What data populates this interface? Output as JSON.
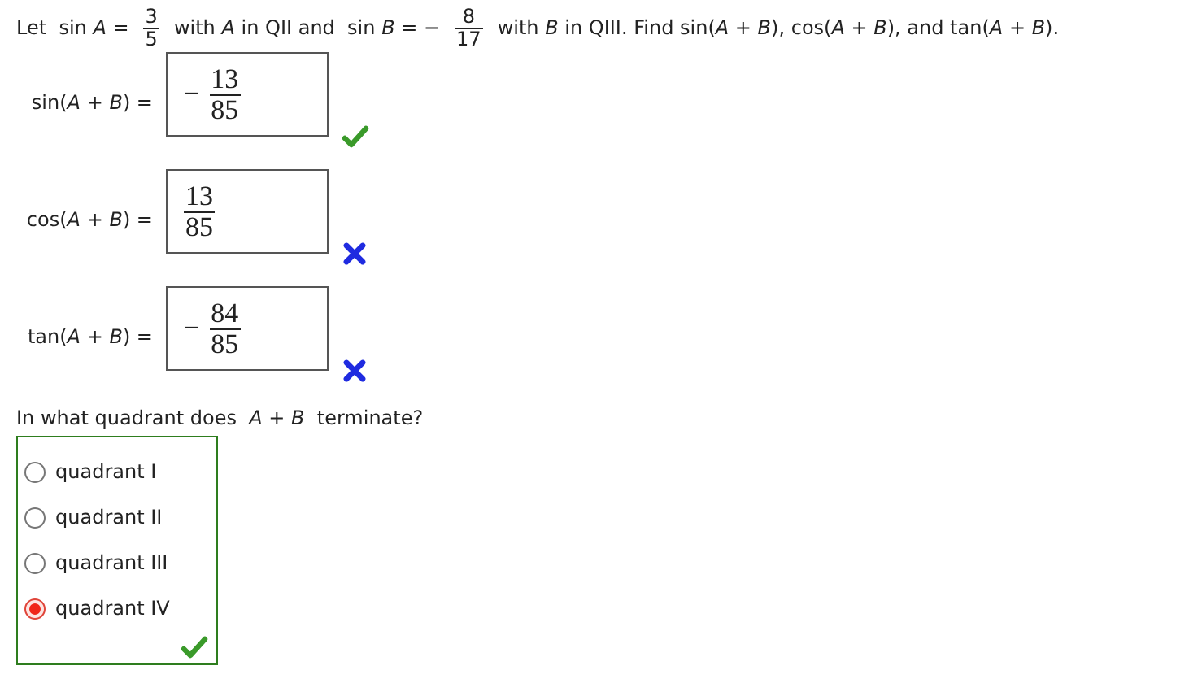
{
  "question": {
    "parts": [
      {
        "kind": "text",
        "text": "Let  sin *A* ="
      },
      {
        "kind": "fraction",
        "numerator": "3",
        "denominator": "5"
      },
      {
        "kind": "text",
        "text": "with *A* in QII and  sin *B* = −"
      },
      {
        "kind": "fraction",
        "numerator": "8",
        "denominator": "17"
      },
      {
        "kind": "text",
        "text": "with *B* in QIII. Find sin(*A* + *B*), cos(*A* + *B*), and tan(*A* + *B*)."
      }
    ]
  },
  "answers": [
    {
      "label": "sin(*A* + *B*) =",
      "sign": "−",
      "numerator": "13",
      "denominator": "85",
      "correct": true
    },
    {
      "label": "cos(*A* + *B*) =",
      "numerator": "13",
      "denominator": "85",
      "correct": false
    },
    {
      "label": "tan(*A* + *B*) =",
      "sign": "−",
      "numerator": "84",
      "denominator": "85",
      "correct": false
    }
  ],
  "quadrant_question": {
    "prompt": "In what quadrant does  *A* + *B*  terminate?",
    "correct": true,
    "options": [
      {
        "label": "quadrant I",
        "selected": false
      },
      {
        "label": "quadrant II",
        "selected": false
      },
      {
        "label": "quadrant III",
        "selected": false
      },
      {
        "label": "quadrant IV",
        "selected": true
      }
    ]
  }
}
